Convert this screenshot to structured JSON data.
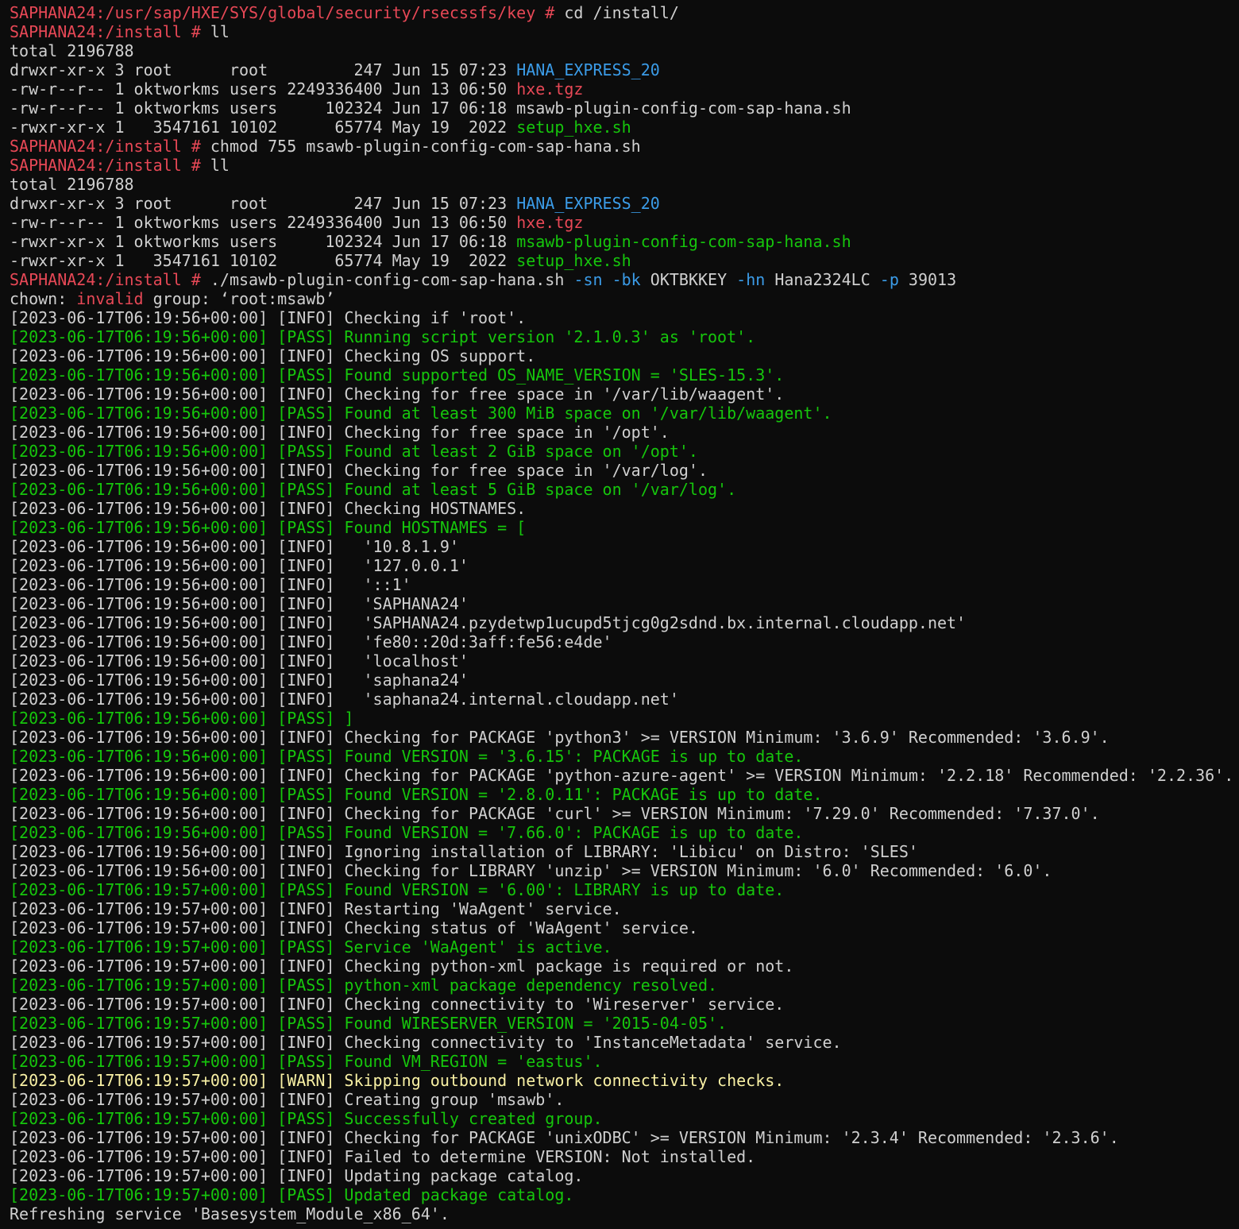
{
  "colors": {
    "background": "#0c0c0c",
    "text": "#d0d0d0",
    "prompt": "#e74856",
    "directory": "#3b9ce8",
    "archive": "#e74856",
    "executable": "#16c60c",
    "pass": "#16c60c",
    "warn": "#f9f1a5",
    "option": "#3b9ce8",
    "error_word": "#e74856"
  },
  "lines": [
    [
      {
        "t": "SAPHANA24:/usr/sap/HXE/SYS/global/security/rsecssfs/key # ",
        "c": "prompt"
      },
      {
        "t": "cd /install/",
        "c": "text"
      }
    ],
    [
      {
        "t": "SAPHANA24:/install # ",
        "c": "prompt"
      },
      {
        "t": "ll",
        "c": "text"
      }
    ],
    [
      {
        "t": "total 2196788",
        "c": "text"
      }
    ],
    [
      {
        "t": "drwxr-xr-x 3 root      root         247 Jun 15 07:23 ",
        "c": "text"
      },
      {
        "t": "HANA_EXPRESS_20",
        "c": "directory"
      }
    ],
    [
      {
        "t": "-rw-r--r-- 1 oktworkms users 2249336400 Jun 13 06:50 ",
        "c": "text"
      },
      {
        "t": "hxe.tgz",
        "c": "archive"
      }
    ],
    [
      {
        "t": "-rw-r--r-- 1 oktworkms users     102324 Jun 17 06:18 msawb-plugin-config-com-sap-hana.sh",
        "c": "text"
      }
    ],
    [
      {
        "t": "-rwxr-xr-x 1   3547161 10102      65774 May 19  2022 ",
        "c": "text"
      },
      {
        "t": "setup_hxe.sh",
        "c": "executable"
      }
    ],
    [
      {
        "t": "SAPHANA24:/install # ",
        "c": "prompt"
      },
      {
        "t": "chmod 755 msawb-plugin-config-com-sap-hana.sh",
        "c": "text"
      }
    ],
    [
      {
        "t": "SAPHANA24:/install # ",
        "c": "prompt"
      },
      {
        "t": "ll",
        "c": "text"
      }
    ],
    [
      {
        "t": "total 2196788",
        "c": "text"
      }
    ],
    [
      {
        "t": "drwxr-xr-x 3 root      root         247 Jun 15 07:23 ",
        "c": "text"
      },
      {
        "t": "HANA_EXPRESS_20",
        "c": "directory"
      }
    ],
    [
      {
        "t": "-rw-r--r-- 1 oktworkms users 2249336400 Jun 13 06:50 ",
        "c": "text"
      },
      {
        "t": "hxe.tgz",
        "c": "archive"
      }
    ],
    [
      {
        "t": "-rwxr-xr-x 1 oktworkms users     102324 Jun 17 06:18 ",
        "c": "text"
      },
      {
        "t": "msawb-plugin-config-com-sap-hana.sh",
        "c": "executable"
      }
    ],
    [
      {
        "t": "-rwxr-xr-x 1   3547161 10102      65774 May 19  2022 ",
        "c": "text"
      },
      {
        "t": "setup_hxe.sh",
        "c": "executable"
      }
    ],
    [
      {
        "t": "SAPHANA24:/install # ",
        "c": "prompt"
      },
      {
        "t": "./msawb-plugin-config-com-sap-hana.sh ",
        "c": "text"
      },
      {
        "t": "-sn -bk",
        "c": "option"
      },
      {
        "t": " OKTBKKEY ",
        "c": "text"
      },
      {
        "t": "-hn",
        "c": "option"
      },
      {
        "t": " Hana2324LC ",
        "c": "text"
      },
      {
        "t": "-p",
        "c": "option"
      },
      {
        "t": " 39013",
        "c": "text"
      }
    ],
    [
      {
        "t": "chown: ",
        "c": "text"
      },
      {
        "t": "invalid",
        "c": "error_word"
      },
      {
        "t": " group: ‘root:msawb’",
        "c": "text"
      }
    ],
    [
      {
        "t": "[2023-06-17T06:19:56+00:00] [INFO] Checking if 'root'.",
        "c": "text"
      }
    ],
    [
      {
        "t": "[2023-06-17T06:19:56+00:00] [PASS] Running script version '2.1.0.3' as 'root'.",
        "c": "pass"
      }
    ],
    [
      {
        "t": "[2023-06-17T06:19:56+00:00] [INFO] Checking OS support.",
        "c": "text"
      }
    ],
    [
      {
        "t": "[2023-06-17T06:19:56+00:00] [PASS] Found supported OS_NAME_VERSION = 'SLES-15.3'.",
        "c": "pass"
      }
    ],
    [
      {
        "t": "[2023-06-17T06:19:56+00:00] [INFO] Checking for free space in '/var/lib/waagent'.",
        "c": "text"
      }
    ],
    [
      {
        "t": "[2023-06-17T06:19:56+00:00] [PASS] Found at least 300 MiB space on '/var/lib/waagent'.",
        "c": "pass"
      }
    ],
    [
      {
        "t": "[2023-06-17T06:19:56+00:00] [INFO] Checking for free space in '/opt'.",
        "c": "text"
      }
    ],
    [
      {
        "t": "[2023-06-17T06:19:56+00:00] [PASS] Found at least 2 GiB space on '/opt'.",
        "c": "pass"
      }
    ],
    [
      {
        "t": "[2023-06-17T06:19:56+00:00] [INFO] Checking for free space in '/var/log'.",
        "c": "text"
      }
    ],
    [
      {
        "t": "[2023-06-17T06:19:56+00:00] [PASS] Found at least 5 GiB space on '/var/log'.",
        "c": "pass"
      }
    ],
    [
      {
        "t": "[2023-06-17T06:19:56+00:00] [INFO] Checking HOSTNAMES.",
        "c": "text"
      }
    ],
    [
      {
        "t": "[2023-06-17T06:19:56+00:00] [PASS] Found HOSTNAMES = [",
        "c": "pass"
      }
    ],
    [
      {
        "t": "[2023-06-17T06:19:56+00:00] [INFO]   '10.8.1.9'",
        "c": "text"
      }
    ],
    [
      {
        "t": "[2023-06-17T06:19:56+00:00] [INFO]   '127.0.0.1'",
        "c": "text"
      }
    ],
    [
      {
        "t": "[2023-06-17T06:19:56+00:00] [INFO]   '::1'",
        "c": "text"
      }
    ],
    [
      {
        "t": "[2023-06-17T06:19:56+00:00] [INFO]   'SAPHANA24'",
        "c": "text"
      }
    ],
    [
      {
        "t": "[2023-06-17T06:19:56+00:00] [INFO]   'SAPHANA24.pzydetwp1ucupd5tjcg0g2sdnd.bx.internal.cloudapp.net'",
        "c": "text"
      }
    ],
    [
      {
        "t": "[2023-06-17T06:19:56+00:00] [INFO]   'fe80::20d:3aff:fe56:e4de'",
        "c": "text"
      }
    ],
    [
      {
        "t": "[2023-06-17T06:19:56+00:00] [INFO]   'localhost'",
        "c": "text"
      }
    ],
    [
      {
        "t": "[2023-06-17T06:19:56+00:00] [INFO]   'saphana24'",
        "c": "text"
      }
    ],
    [
      {
        "t": "[2023-06-17T06:19:56+00:00] [INFO]   'saphana24.internal.cloudapp.net'",
        "c": "text"
      }
    ],
    [
      {
        "t": "[2023-06-17T06:19:56+00:00] [PASS] ]",
        "c": "pass"
      }
    ],
    [
      {
        "t": "[2023-06-17T06:19:56+00:00] [INFO] Checking for PACKAGE 'python3' >= VERSION Minimum: '3.6.9' Recommended: '3.6.9'.",
        "c": "text"
      }
    ],
    [
      {
        "t": "[2023-06-17T06:19:56+00:00] [PASS] Found VERSION = '3.6.15': PACKAGE is up to date.",
        "c": "pass"
      }
    ],
    [
      {
        "t": "[2023-06-17T06:19:56+00:00] [INFO] Checking for PACKAGE 'python-azure-agent' >= VERSION Minimum: '2.2.18' Recommended: '2.2.36'.",
        "c": "text"
      }
    ],
    [
      {
        "t": "[2023-06-17T06:19:56+00:00] [PASS] Found VERSION = '2.8.0.11': PACKAGE is up to date.",
        "c": "pass"
      }
    ],
    [
      {
        "t": "[2023-06-17T06:19:56+00:00] [INFO] Checking for PACKAGE 'curl' >= VERSION Minimum: '7.29.0' Recommended: '7.37.0'.",
        "c": "text"
      }
    ],
    [
      {
        "t": "[2023-06-17T06:19:56+00:00] [PASS] Found VERSION = '7.66.0': PACKAGE is up to date.",
        "c": "pass"
      }
    ],
    [
      {
        "t": "[2023-06-17T06:19:56+00:00] [INFO] Ignoring installation of LIBRARY: 'Libicu' on Distro: 'SLES'",
        "c": "text"
      }
    ],
    [
      {
        "t": "[2023-06-17T06:19:56+00:00] [INFO] Checking for LIBRARY 'unzip' >= VERSION Minimum: '6.0' Recommended: '6.0'.",
        "c": "text"
      }
    ],
    [
      {
        "t": "[2023-06-17T06:19:57+00:00] [PASS] Found VERSION = '6.00': LIBRARY is up to date.",
        "c": "pass"
      }
    ],
    [
      {
        "t": "[2023-06-17T06:19:57+00:00] [INFO] Restarting 'WaAgent' service.",
        "c": "text"
      }
    ],
    [
      {
        "t": "[2023-06-17T06:19:57+00:00] [INFO] Checking status of 'WaAgent' service.",
        "c": "text"
      }
    ],
    [
      {
        "t": "[2023-06-17T06:19:57+00:00] [PASS] Service 'WaAgent' is active.",
        "c": "pass"
      }
    ],
    [
      {
        "t": "[2023-06-17T06:19:57+00:00] [INFO] Checking python-xml package is required or not.",
        "c": "text"
      }
    ],
    [
      {
        "t": "[2023-06-17T06:19:57+00:00] [PASS] python-xml package dependency resolved.",
        "c": "pass"
      }
    ],
    [
      {
        "t": "[2023-06-17T06:19:57+00:00] [INFO] Checking connectivity to 'Wireserver' service.",
        "c": "text"
      }
    ],
    [
      {
        "t": "[2023-06-17T06:19:57+00:00] [PASS] Found WIRESERVER_VERSION = '2015-04-05'.",
        "c": "pass"
      }
    ],
    [
      {
        "t": "[2023-06-17T06:19:57+00:00] [INFO] Checking connectivity to 'InstanceMetadata' service.",
        "c": "text"
      }
    ],
    [
      {
        "t": "[2023-06-17T06:19:57+00:00] [PASS] Found VM_REGION = 'eastus'.",
        "c": "pass"
      }
    ],
    [
      {
        "t": "[2023-06-17T06:19:57+00:00] [WARN] Skipping outbound network connectivity checks.",
        "c": "warn"
      }
    ],
    [
      {
        "t": "[2023-06-17T06:19:57+00:00] [INFO] Creating group 'msawb'.",
        "c": "text"
      }
    ],
    [
      {
        "t": "[2023-06-17T06:19:57+00:00] [PASS] Successfully created group.",
        "c": "pass"
      }
    ],
    [
      {
        "t": "[2023-06-17T06:19:57+00:00] [INFO] Checking for PACKAGE 'unixODBC' >= VERSION Minimum: '2.3.4' Recommended: '2.3.6'.",
        "c": "text"
      }
    ],
    [
      {
        "t": "[2023-06-17T06:19:57+00:00] [INFO] Failed to determine VERSION: Not installed.",
        "c": "text"
      }
    ],
    [
      {
        "t": "[2023-06-17T06:19:57+00:00] [INFO] Updating package catalog.",
        "c": "text"
      }
    ],
    [
      {
        "t": "[2023-06-17T06:19:57+00:00] [PASS] Updated package catalog.",
        "c": "pass"
      }
    ],
    [
      {
        "t": "Refreshing service 'Basesystem_Module_x86_64'.",
        "c": "text"
      }
    ]
  ]
}
